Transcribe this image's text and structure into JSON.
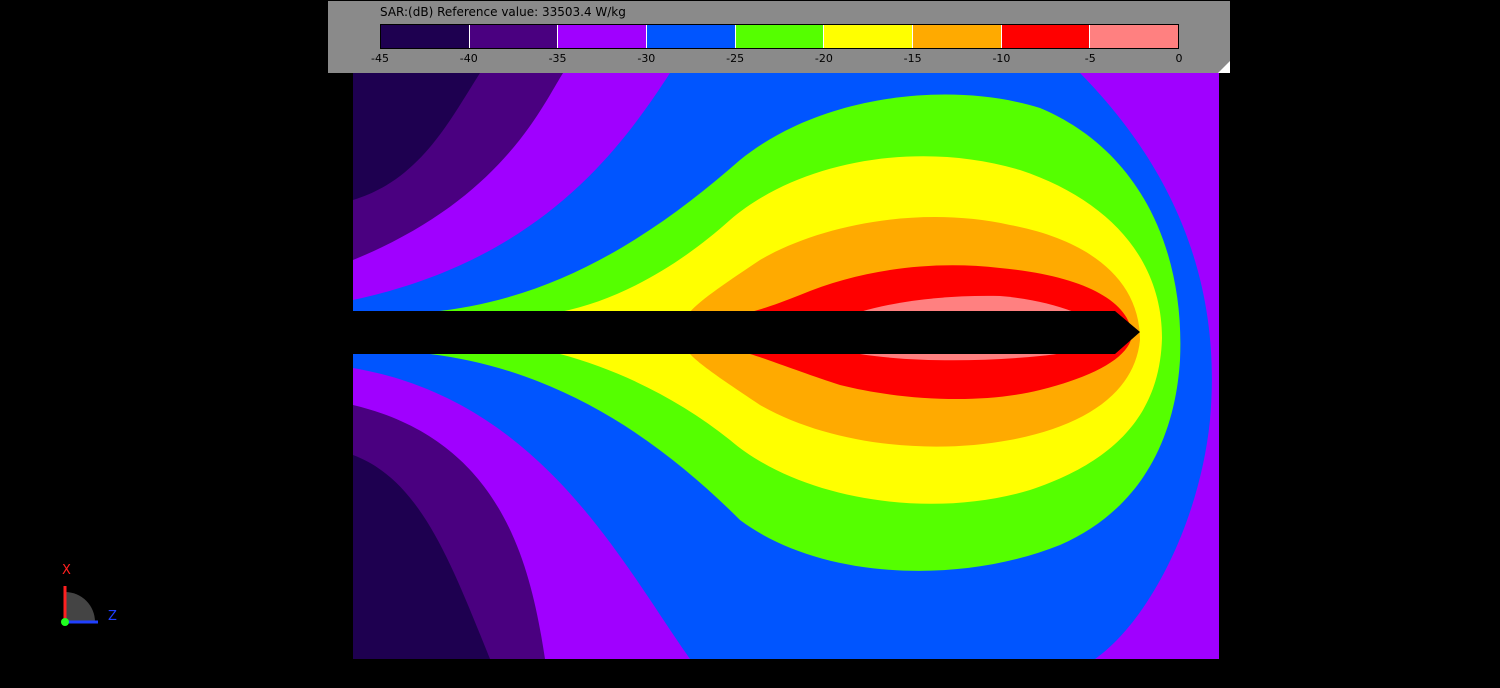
{
  "legend": {
    "title": "SAR:(dB) Reference value: 33503.4 W/kg",
    "colors": [
      "#1e0050",
      "#4a0080",
      "#a000ff",
      "#0055ff",
      "#55ff00",
      "#ffff00",
      "#ffaa00",
      "#ff0000",
      "#ff8080"
    ],
    "ticks": [
      "-45",
      "-40",
      "-35",
      "-30",
      "-25",
      "-20",
      "-15",
      "-10",
      "-5",
      "0"
    ]
  },
  "axes": {
    "x_label": "X",
    "z_label": "Z"
  },
  "colors": {
    "x_axis": "#ff2020",
    "z_axis": "#2040ff",
    "origin": "#20ff20",
    "background": "#000000",
    "panel": "#8a8a8a"
  }
}
